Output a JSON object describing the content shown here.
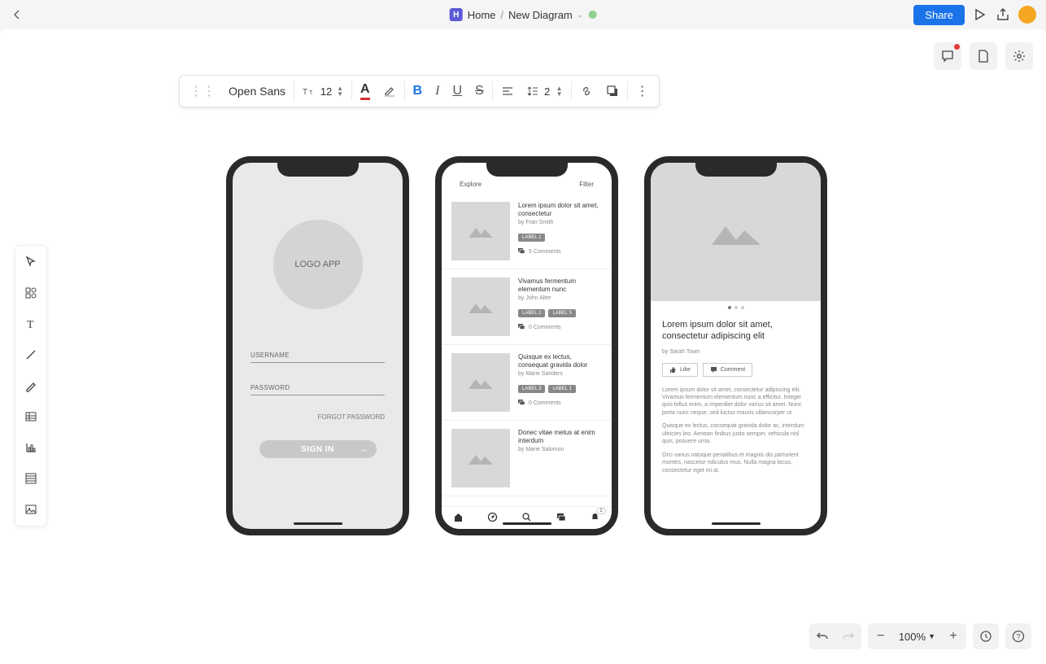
{
  "header": {
    "logo_letter": "H",
    "home": "Home",
    "separator": "/",
    "diagram_name": "New Diagram",
    "share_label": "Share"
  },
  "text_toolbar": {
    "font_name": "Open Sans",
    "font_size": "12",
    "line_spacing": "2"
  },
  "phone1": {
    "logo_text": "LOGO APP",
    "username_label": "USERNAME",
    "password_label": "PASSWORD",
    "forgot_label": "FORGOT PASSWORD",
    "signin_label": "SIGN IN"
  },
  "phone2": {
    "tab_explore": "Explore",
    "tab_filter": "Filter",
    "items": [
      {
        "title": "Lorem ipsum dolor sit amet, consectetur",
        "author": "by Fran Smith",
        "labels": [
          "LABEL 1"
        ],
        "comments": "5 Comments"
      },
      {
        "title": "Vivamus fermentum elementum nunc",
        "author": "by John Alter",
        "labels": [
          "LABEL 2",
          "LABEL 5"
        ],
        "comments": "0 Comments"
      },
      {
        "title": "Quisque ex lectus, consequat gravida dolor",
        "author": "by Marie Sanders",
        "labels": [
          "LABEL 3",
          "LABEL 1"
        ],
        "comments": "0 Comments"
      },
      {
        "title": "Donec vitae metus at enim interdum",
        "author": "by Marie Salomon",
        "labels": [],
        "comments": ""
      }
    ],
    "nav_badge": "1"
  },
  "phone3": {
    "title": "Lorem ipsum dolor sit amet, consectetur adipiscing elit",
    "author": "by Sarah Town",
    "like_label": "Like",
    "comment_label": "Comment",
    "para1": "Lorem ipsum dolor sit amet, consectetur adipiscing elit. Vivamus fermentum elementum nunc a efficitur. Integer quis tellus enim, a imperdiet dolor varius sit amet. Nunc porta nunc neque, sed luctus mauris ullamcorper ut.",
    "para2": "Quisque ex lectus, consequat gravida dolor ac, interdum ultricies leo. Aenean finibus justo semper, vehicula nisl quis, posuere urna.",
    "para3": "Orci varius natoque penatibus et magnis dis parturient montes, nascetur ridiculus mus. Nulla magna lacus, consectetur eget mi at."
  },
  "footer": {
    "zoom": "100%"
  }
}
